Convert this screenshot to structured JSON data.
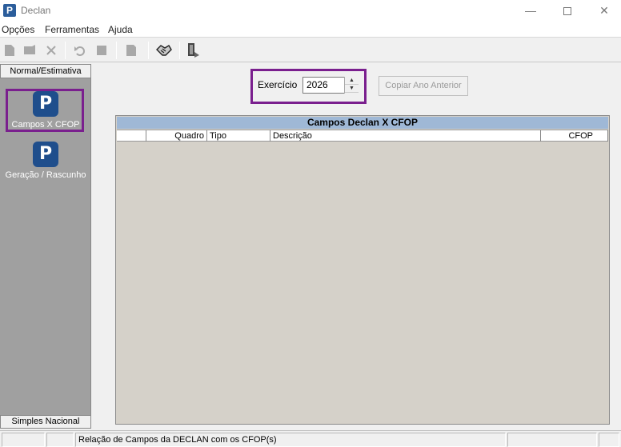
{
  "window": {
    "title": "Declan",
    "app_icon_letter": "P",
    "minimize": "—",
    "close": "✕"
  },
  "menu": {
    "items": [
      "Opções",
      "Ferramentas",
      "Ajuda"
    ]
  },
  "sidebar": {
    "header": "Normal/Estimativa",
    "footer": "Simples Nacional",
    "items": [
      {
        "label": "Campos X CFOP",
        "icon_letter": "P",
        "selected": true
      },
      {
        "label": "Geração / Rascunho",
        "icon_letter": "P",
        "selected": false
      }
    ]
  },
  "exercicio": {
    "label": "Exercício",
    "value": "2026"
  },
  "copy_button": {
    "label": "Copiar Ano Anterior",
    "enabled": false
  },
  "grid": {
    "title": "Campos Declan X CFOP",
    "columns": [
      "Quadro",
      "Tipo",
      "Descrição",
      "CFOP"
    ]
  },
  "status": {
    "message": "Relação de Campos da DECLAN com os CFOP(s)"
  },
  "colors": {
    "highlight": "#7a1f8e",
    "grid_title_bg": "#9fb8d6",
    "icon_bg": "#1f4e8c"
  }
}
